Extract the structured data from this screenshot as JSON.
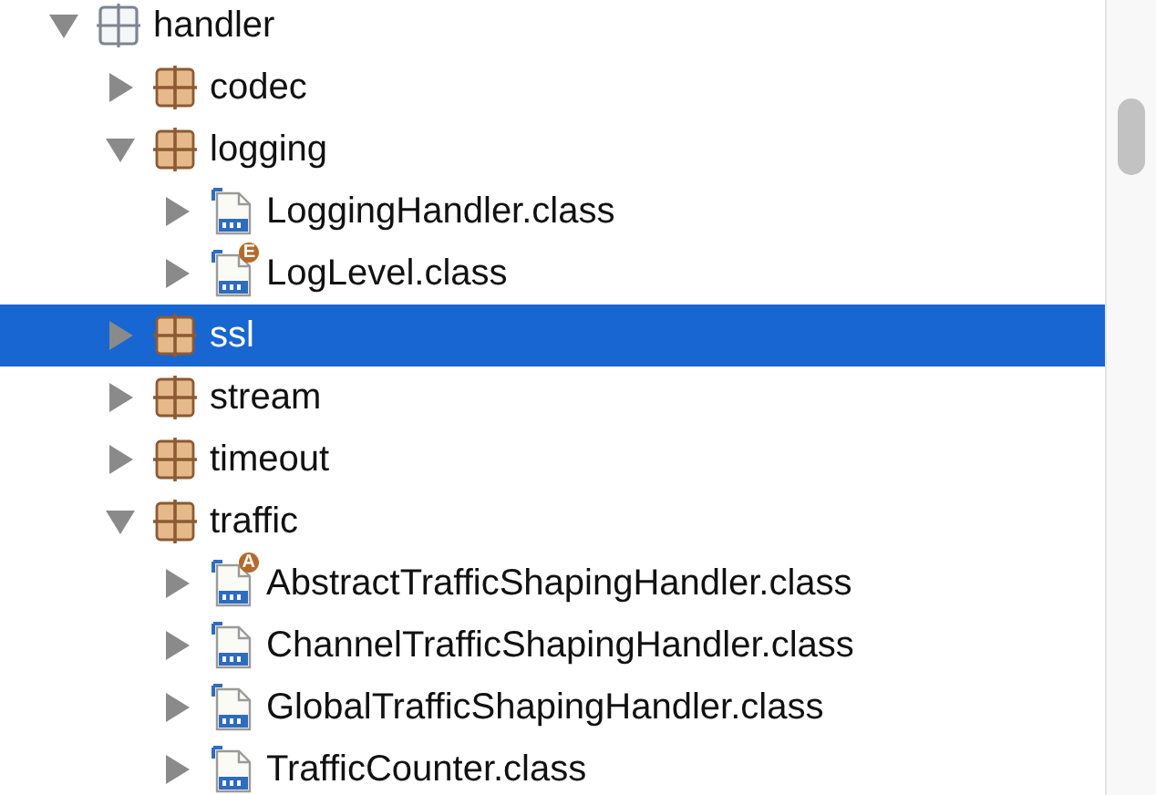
{
  "tree": [
    {
      "label": "handler",
      "kind": "root-package",
      "expanded": true,
      "selected": false,
      "children": [
        {
          "label": "codec",
          "kind": "package",
          "expanded": false,
          "selected": false
        },
        {
          "label": "logging",
          "kind": "package",
          "expanded": true,
          "selected": false,
          "children": [
            {
              "label": "LoggingHandler.class",
              "kind": "class",
              "expanded": false,
              "selected": false
            },
            {
              "label": "LogLevel.class",
              "kind": "class",
              "badge": "E",
              "expanded": false,
              "selected": false
            }
          ]
        },
        {
          "label": "ssl",
          "kind": "package",
          "expanded": false,
          "selected": true
        },
        {
          "label": "stream",
          "kind": "package",
          "expanded": false,
          "selected": false
        },
        {
          "label": "timeout",
          "kind": "package",
          "expanded": false,
          "selected": false
        },
        {
          "label": "traffic",
          "kind": "package",
          "expanded": true,
          "selected": false,
          "children": [
            {
              "label": "AbstractTrafficShapingHandler.class",
              "kind": "class",
              "badge": "A",
              "expanded": false,
              "selected": false
            },
            {
              "label": "ChannelTrafficShapingHandler.class",
              "kind": "class",
              "expanded": false,
              "selected": false
            },
            {
              "label": "GlobalTrafficShapingHandler.class",
              "kind": "class",
              "expanded": false,
              "selected": false
            },
            {
              "label": "TrafficCounter.class",
              "kind": "class",
              "expanded": false,
              "selected": false
            }
          ]
        }
      ]
    }
  ]
}
